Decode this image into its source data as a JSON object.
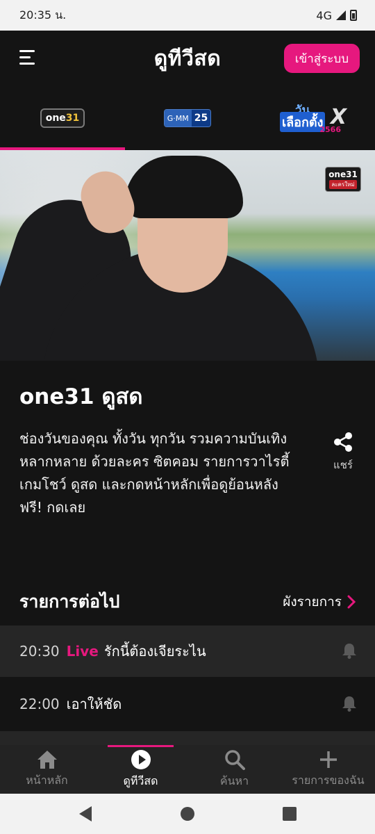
{
  "status_bar": {
    "time": "20:35 น.",
    "network": "4G"
  },
  "header": {
    "title": "ดูทีวีสด",
    "login_label": "เข้าสู่ระบบ"
  },
  "channels": [
    {
      "logo_text_1": "one",
      "logo_text_2": "31",
      "active": true
    },
    {
      "logo_text_1": "G·MM",
      "logo_text_2": "25",
      "active": false
    },
    {
      "logo_text_1": "วัน",
      "logo_text_2": "เลือกตั้ง",
      "logo_text_3": "X",
      "logo_text_4": "2566",
      "active": false
    }
  ],
  "hero": {
    "watermark_top": "one31",
    "watermark_bottom": "ละครใหม่"
  },
  "channel_info": {
    "name": "one31 ดูสด",
    "description": "ช่องวันของคุณ ทั้งวัน ทุกวัน รวมความบันเทิง\nหลากหลาย ด้วยละคร ซิตคอม รายการวาไรตี้ เกมโชว์ ดูสด และกดหน้าหลักเพื่อดูย้อนหลัง ฟรี! กดเลย",
    "share_label": "แชร์"
  },
  "upcoming": {
    "title": "รายการต่อไป",
    "schedule_label": "ผังรายการ",
    "items": [
      {
        "time": "20:30",
        "live": "Live",
        "title": "รักนี้ต้องเจียระไน"
      },
      {
        "time": "22:00",
        "live": "",
        "title": "เอาให้ชัด"
      }
    ]
  },
  "bottom_nav": [
    {
      "label": "หน้าหลัก",
      "icon": "home-icon"
    },
    {
      "label": "ดูทีวีสด",
      "icon": "play-circle-icon"
    },
    {
      "label": "ค้นหา",
      "icon": "search-icon"
    },
    {
      "label": "รายการของฉัน",
      "icon": "plus-icon"
    }
  ],
  "colors": {
    "accent": "#e6187e",
    "background": "#141414",
    "row_highlight": "#262626"
  }
}
